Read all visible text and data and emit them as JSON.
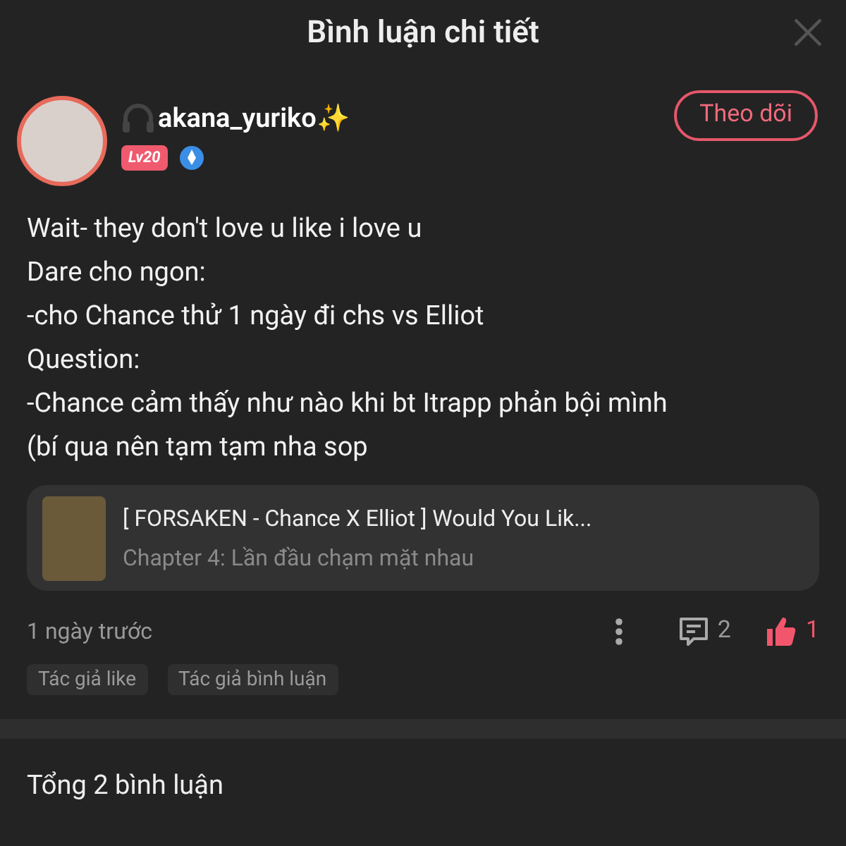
{
  "header": {
    "title": "Bình luận chi tiết"
  },
  "comment": {
    "username": "akana_yuriko✨",
    "level_badge": "Lv20",
    "follow_button": "Theo dõi",
    "lines": [
      "Wait- they don't love u like i love u",
      "Dare cho ngon:",
      "-cho Chance thử 1 ngày đi chs vs Elliot",
      "Question:",
      "-Chance cảm thấy như nào khi bt Itrapp phản bội mình",
      "(bí qua nên tạm tạm nha sop"
    ],
    "story": {
      "title": "[ FORSAKEN - Chance X Elliot ] Would You Lik...",
      "chapter": "Chapter 4: Lần đầu chạm mặt nhau"
    },
    "time": "1 ngày trước",
    "reply_count": "2",
    "like_count": "1",
    "liked": true,
    "tags": [
      "Tác giả like",
      "Tác giả bình luận"
    ]
  },
  "total": "Tổng 2 bình luận"
}
